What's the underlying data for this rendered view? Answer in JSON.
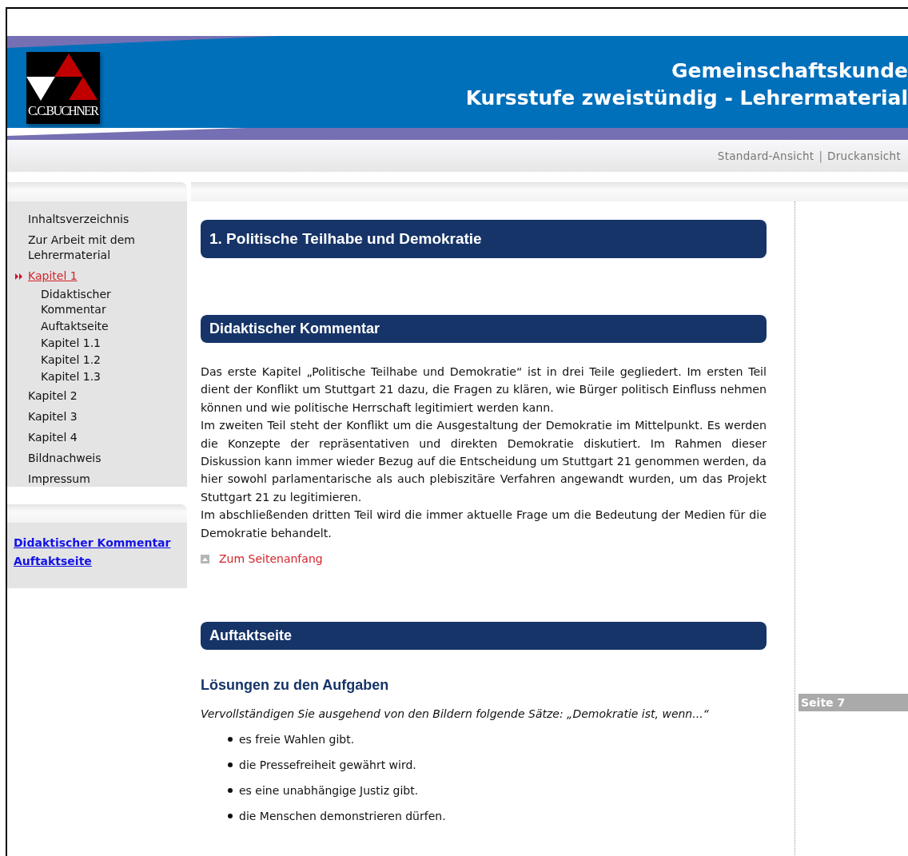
{
  "header": {
    "logo_text": "C.C.BUCHNER",
    "title_lines": [
      "Gemeinschaftskunde",
      "Kursstufe zweistündig - Lehrermaterial"
    ]
  },
  "view_links": {
    "items": [
      "Standard-Ansicht",
      "Druckansicht"
    ],
    "separator": "|"
  },
  "sidebar": {
    "items": [
      {
        "label": "Inhaltsverzeichnis",
        "selected": false
      },
      {
        "label": "Zur Arbeit mit dem Lehrermaterial",
        "selected": false
      },
      {
        "label": "Kapitel 1",
        "selected": true,
        "children": [
          {
            "label": "Didaktischer Kommentar",
            "selected": false
          },
          {
            "label": "Auftaktseite",
            "selected": false
          },
          {
            "label": "Kapitel 1.1",
            "selected": false
          },
          {
            "label": "Kapitel 1.2",
            "selected": false
          },
          {
            "label": "Kapitel 1.3",
            "selected": false
          }
        ]
      },
      {
        "label": "Kapitel 2",
        "selected": false
      },
      {
        "label": "Kapitel 3",
        "selected": false
      },
      {
        "label": "Kapitel 4",
        "selected": false
      },
      {
        "label": "Bildnachweis",
        "selected": false
      },
      {
        "label": "Impressum",
        "selected": false
      }
    ],
    "quick_links": [
      "Didaktischer Kommentar",
      "Auftaktseite"
    ]
  },
  "content": {
    "chapter_title": "1. Politische Teilhabe und Demokratie",
    "sections": [
      {
        "heading": "Didaktischer Kommentar",
        "paragraphs": [
          "Das erste Kapitel „Politische Teilhabe und Demokratie“ ist in drei Teile gegliedert. Im ersten Teil dient der Konflikt um Stuttgart 21 dazu, die Fragen zu klären, wie Bürger politisch Einfluss nehmen können und wie politische Herrschaft legitimiert werden kann.",
          "Im zweiten Teil steht der Konflikt um die Ausgestaltung der Demokratie im Mittelpunkt. Es werden die Konzepte der repräsentativen und direkten Demokratie diskutiert. Im Rahmen dieser Diskussion kann immer wieder Bezug auf die Entscheidung um Stuttgart 21 genommen werden, da hier sowohl parlamentarische als auch plebiszitäre Verfahren angewandt wurden, um das Projekt Stuttgart 21 zu legitimieren.",
          "Im abschließenden dritten Teil wird die immer aktuelle Frage um die Bedeutung der Medien für die Demokratie behandelt."
        ],
        "back_to_top": "Zum Seitenanfang"
      },
      {
        "heading": "Auftaktseite",
        "subheading": "Lösungen zu den Aufgaben",
        "instruction": "Vervollständigen Sie ausgehend von den Bildern folgende Sätze: „Demokratie ist, wenn...“",
        "bullets": [
          "es freie Wahlen gibt.",
          "die Pressefreiheit gewährt wird.",
          "es eine unabhängige Justiz gibt.",
          "die Menschen demonstrieren dürfen."
        ]
      }
    ]
  },
  "margin_label": "Seite 7"
}
